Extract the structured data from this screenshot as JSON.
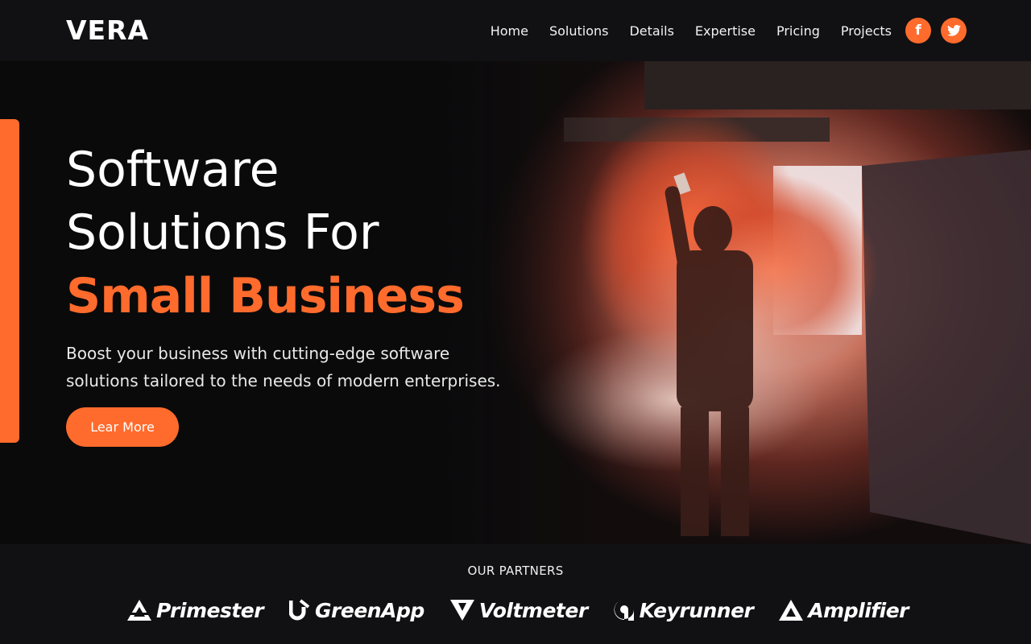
{
  "brand": {
    "logo": "VERA"
  },
  "nav": {
    "items": [
      {
        "label": "Home"
      },
      {
        "label": "Solutions"
      },
      {
        "label": "Details"
      },
      {
        "label": "Expertise"
      },
      {
        "label": "Pricing"
      },
      {
        "label": "Projects"
      }
    ],
    "social": [
      {
        "icon": "facebook-icon",
        "glyph": "f"
      },
      {
        "icon": "twitter-icon"
      }
    ]
  },
  "hero": {
    "line1": "Software",
    "line2": "Solutions For",
    "accent": "Small Business",
    "subtext": "Boost your business with cutting-edge software solutions tailored to the needs of modern enterprises.",
    "cta": "Lear More",
    "image": "person-holding-orange-smoke-flare-in-tunnel"
  },
  "partners": {
    "title": "OUR PARTNERS",
    "items": [
      {
        "name": "Primester",
        "icon": "primester-logo-icon"
      },
      {
        "name": "GreenApp",
        "icon": "greenapp-logo-icon"
      },
      {
        "name": "Voltmeter",
        "icon": "voltmeter-logo-icon"
      },
      {
        "name": "Keyrunner",
        "icon": "keyrunner-logo-icon"
      },
      {
        "name": "Amplifier",
        "icon": "amplifier-logo-icon"
      }
    ]
  },
  "colors": {
    "accent": "#ff6b2c",
    "background": "#0a0a0b",
    "navbar": "#111113"
  }
}
